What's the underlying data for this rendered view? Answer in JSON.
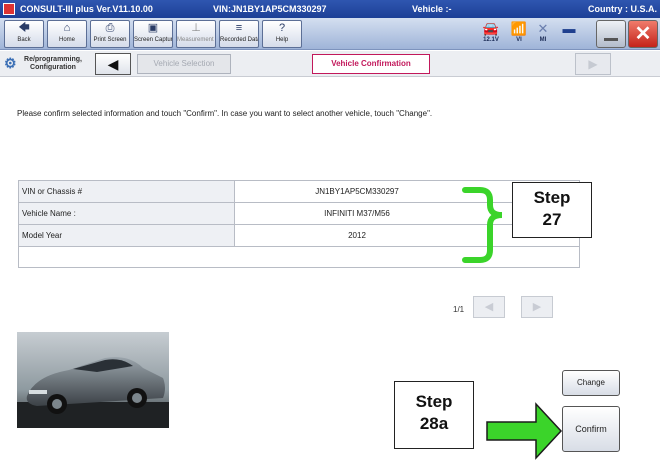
{
  "titlebar": {
    "app": "CONSULT-III plus  Ver.V11.10.00",
    "vin": "VIN:JN1BY1AP5CM330297",
    "vehicle": "Vehicle :-",
    "country": "Country : U.S.A."
  },
  "toolbar": {
    "buttons": [
      {
        "label": "Back",
        "icon": "back-arrow-icon",
        "glyph": "🡄"
      },
      {
        "label": "Home",
        "icon": "home-icon",
        "glyph": "⌂"
      },
      {
        "label": "Print Screen",
        "icon": "printer-icon",
        "glyph": "⎙"
      },
      {
        "label": "Screen Capture",
        "icon": "camera-icon",
        "glyph": "▣"
      },
      {
        "label": "Measurement Mode",
        "icon": "measurement-icon",
        "glyph": "⊥"
      },
      {
        "label": "Recorded Data",
        "icon": "recorded-data-icon",
        "glyph": "≡"
      },
      {
        "label": "Help",
        "icon": "help-icon",
        "glyph": "?"
      }
    ],
    "status": [
      {
        "label": "12.1V",
        "icon": "car-battery-icon",
        "glyph": "🚘"
      },
      {
        "label": "VI",
        "icon": "signal-icon",
        "glyph": "📶"
      },
      {
        "label": "MI",
        "icon": "mi-disconnected-icon",
        "glyph": "✕"
      }
    ]
  },
  "breadcrumb": {
    "reprog_label": "Re/programming, Configuration",
    "back_glyph": "◀",
    "vehicle_selection": "Vehicle Selection",
    "vehicle_confirmation": "Vehicle Confirmation",
    "forward_glyph": "▶"
  },
  "main": {
    "instruction": "Please confirm selected information and touch \"Confirm\". In case you want to select another vehicle, touch \"Change\".",
    "rows": [
      {
        "label": "VIN or Chassis #",
        "value": "JN1BY1AP5CM330297"
      },
      {
        "label": "Vehicle Name :",
        "value": "INFINITI M37/M56"
      },
      {
        "label": "Model Year",
        "value": "2012"
      }
    ],
    "page": "1/1",
    "prev_glyph": "◀",
    "next_glyph": "▶",
    "change_button": "Change",
    "confirm_button": "Confirm"
  },
  "callouts": {
    "step27": {
      "line1": "Step",
      "line2": "27"
    },
    "step28a": {
      "line1": "Step",
      "line2": "28a"
    },
    "bracket_color": "#3bd42a",
    "arrow_color": "#3bd42a"
  }
}
